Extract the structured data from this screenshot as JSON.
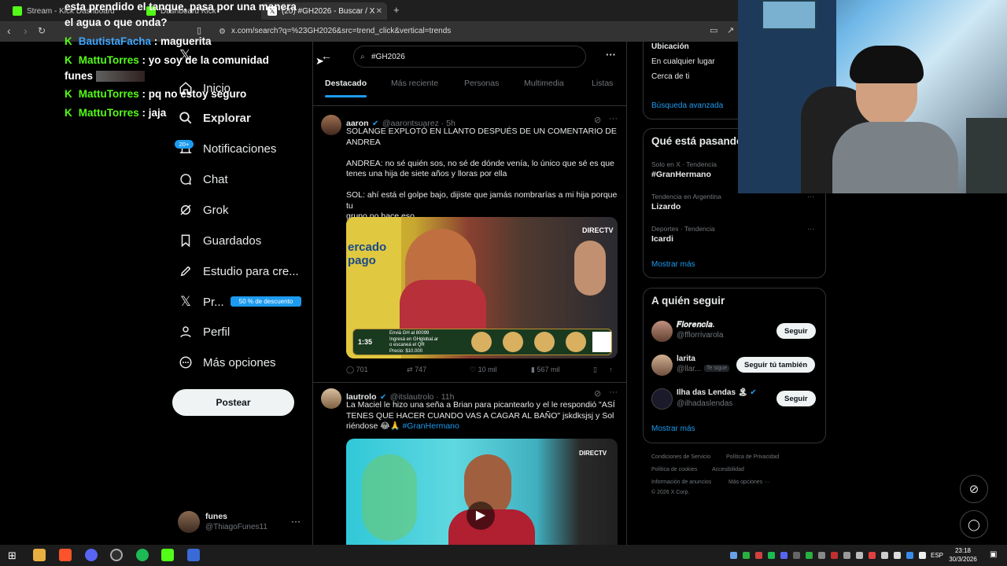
{
  "browser": {
    "tabs": [
      {
        "label": "Stream - Kick Dashboard",
        "color": "#53fc18"
      },
      {
        "label": "Dashboard Kick",
        "color": "#53fc18"
      },
      {
        "label": "Buscar / X",
        "color": "#888888"
      },
      {
        "label": "(20) #GH2026 - Buscar / X",
        "color": "#888888"
      }
    ],
    "new_tab": "+",
    "url": "x.com/search?q=%23GH2026&src=trend_click&vertical=trends"
  },
  "chat": [
    {
      "user": "",
      "text": "esta prendido el tanque, pasa por una manera"
    },
    {
      "user": "",
      "text": "el agua o que onda?"
    },
    {
      "user": "BautistaFacha",
      "text": ": maguerita",
      "blue": true
    },
    {
      "user": "MattuTorres",
      "text": ": yo soy de la comunidad"
    },
    {
      "user": "",
      "text": "funes"
    },
    {
      "user": "MattuTorres",
      "text": ": pq no estoy seguro"
    },
    {
      "user": "MattuTorres",
      "text": ": jaja"
    }
  ],
  "sidebar": {
    "items": [
      {
        "label": "Inicio",
        "icon": "home-icon"
      },
      {
        "label": "Explorar",
        "icon": "search-icon"
      },
      {
        "label": "Notificaciones",
        "icon": "bell-icon",
        "badge": "20+"
      },
      {
        "label": "Chat",
        "icon": "chat-icon"
      },
      {
        "label": "Grok",
        "icon": "grok-icon"
      },
      {
        "label": "Guardados",
        "icon": "bookmark-icon"
      },
      {
        "label": "Estudio para cre...",
        "icon": "rocket-icon"
      },
      {
        "label": "Pr...",
        "icon": "x-icon",
        "promo": "50 % de descuento"
      },
      {
        "label": "Perfil",
        "icon": "person-icon"
      },
      {
        "label": "Más opciones",
        "icon": "more-icon"
      }
    ],
    "post_button": "Postear",
    "account": {
      "name": "funes",
      "handle": "@ThiagoFunes11"
    }
  },
  "feed": {
    "search_value": "#GH2026",
    "tabs": [
      "Destacado",
      "Más reciente",
      "Personas",
      "Multimedia",
      "Listas"
    ],
    "tweets": [
      {
        "name": "aaron",
        "handle": "@aarontsuarez · 5h",
        "text": "SOLANGE EXPLOTÓ EN LLANTO DESPUÉS DE UN COMENTARIO DE\nANDREA\n\nANDREA: no sé quién sos, no sé de dónde venía, lo único que sé es que\ntenes una hija de siete años y lloras por ella\n\nSOL: ahí está el golpe bajo, dijiste que jamás nombrarías a mi hija porque tu\ngrupo no hace eso",
        "media_overlay": {
          "brand": "DIRECTV",
          "timer": "1:35",
          "banner": "Enviá GH al 80099",
          "banner2": "Ingresá en GHglobal.ar",
          "banner3": "o escaneá el QR",
          "banner4": "Precio: $10.000",
          "left_sign": "ercado\npago"
        },
        "stats": {
          "replies": "701",
          "retweets": "747",
          "likes": "10 mil",
          "views": "567 mil"
        }
      },
      {
        "name": "lautrolo",
        "handle": "@itslautrolo · 11h",
        "text": "La Maciel le hizo una seña a Brian para picantearlo y el le respondió \"ASÍ\nTENES QUE HACER CUANDO VAS A CAGAR AL BAÑO\" jskdksjsj y Sol\nriéndose 😂🙏",
        "hashtag": "#GranHermano",
        "media_overlay": {
          "brand": "DIRECTV"
        }
      }
    ]
  },
  "right": {
    "location": {
      "title": "Ubicación",
      "opt1": "En cualquier lugar",
      "opt2": "Cerca de ti",
      "advanced": "Búsqueda avanzada"
    },
    "trends": {
      "title": "Qué está pasando",
      "items": [
        {
          "meta": "Solo en X · Tendencia",
          "name": "#GranHermano"
        },
        {
          "meta": "Tendencia en Argentina",
          "name": "Lizardo"
        },
        {
          "meta": "Deportes · Tendencia",
          "name": "Icardi"
        }
      ],
      "more": "Mostrar más"
    },
    "follow": {
      "title": "A quién seguir",
      "items": [
        {
          "name": "𝑭𝒍𝒐𝒓𝒆𝒏𝒄𝒊𝒂.",
          "handle": "@fflorrivarola",
          "button": "Seguir"
        },
        {
          "name": "larita",
          "handle": "@llar...",
          "tag": "Te sigue",
          "button": "Seguir tú también"
        },
        {
          "name": "Ilha das Lendas 🏝",
          "handle": "@ilhadaslendas",
          "button": "Seguir"
        }
      ],
      "more": "Mostrar más"
    },
    "footer": {
      "l1": "Condiciones de Servicio",
      "l2": "Política de Privacidad",
      "l3": "Política de cookies",
      "l4": "Accesibilidad",
      "l5": "Información de anuncios",
      "l6": "Más opciones ···",
      "l7": "© 2026 X Corp."
    }
  },
  "taskbar": {
    "lang": "ESP",
    "time": "23:18",
    "date": "30/3/2026"
  }
}
